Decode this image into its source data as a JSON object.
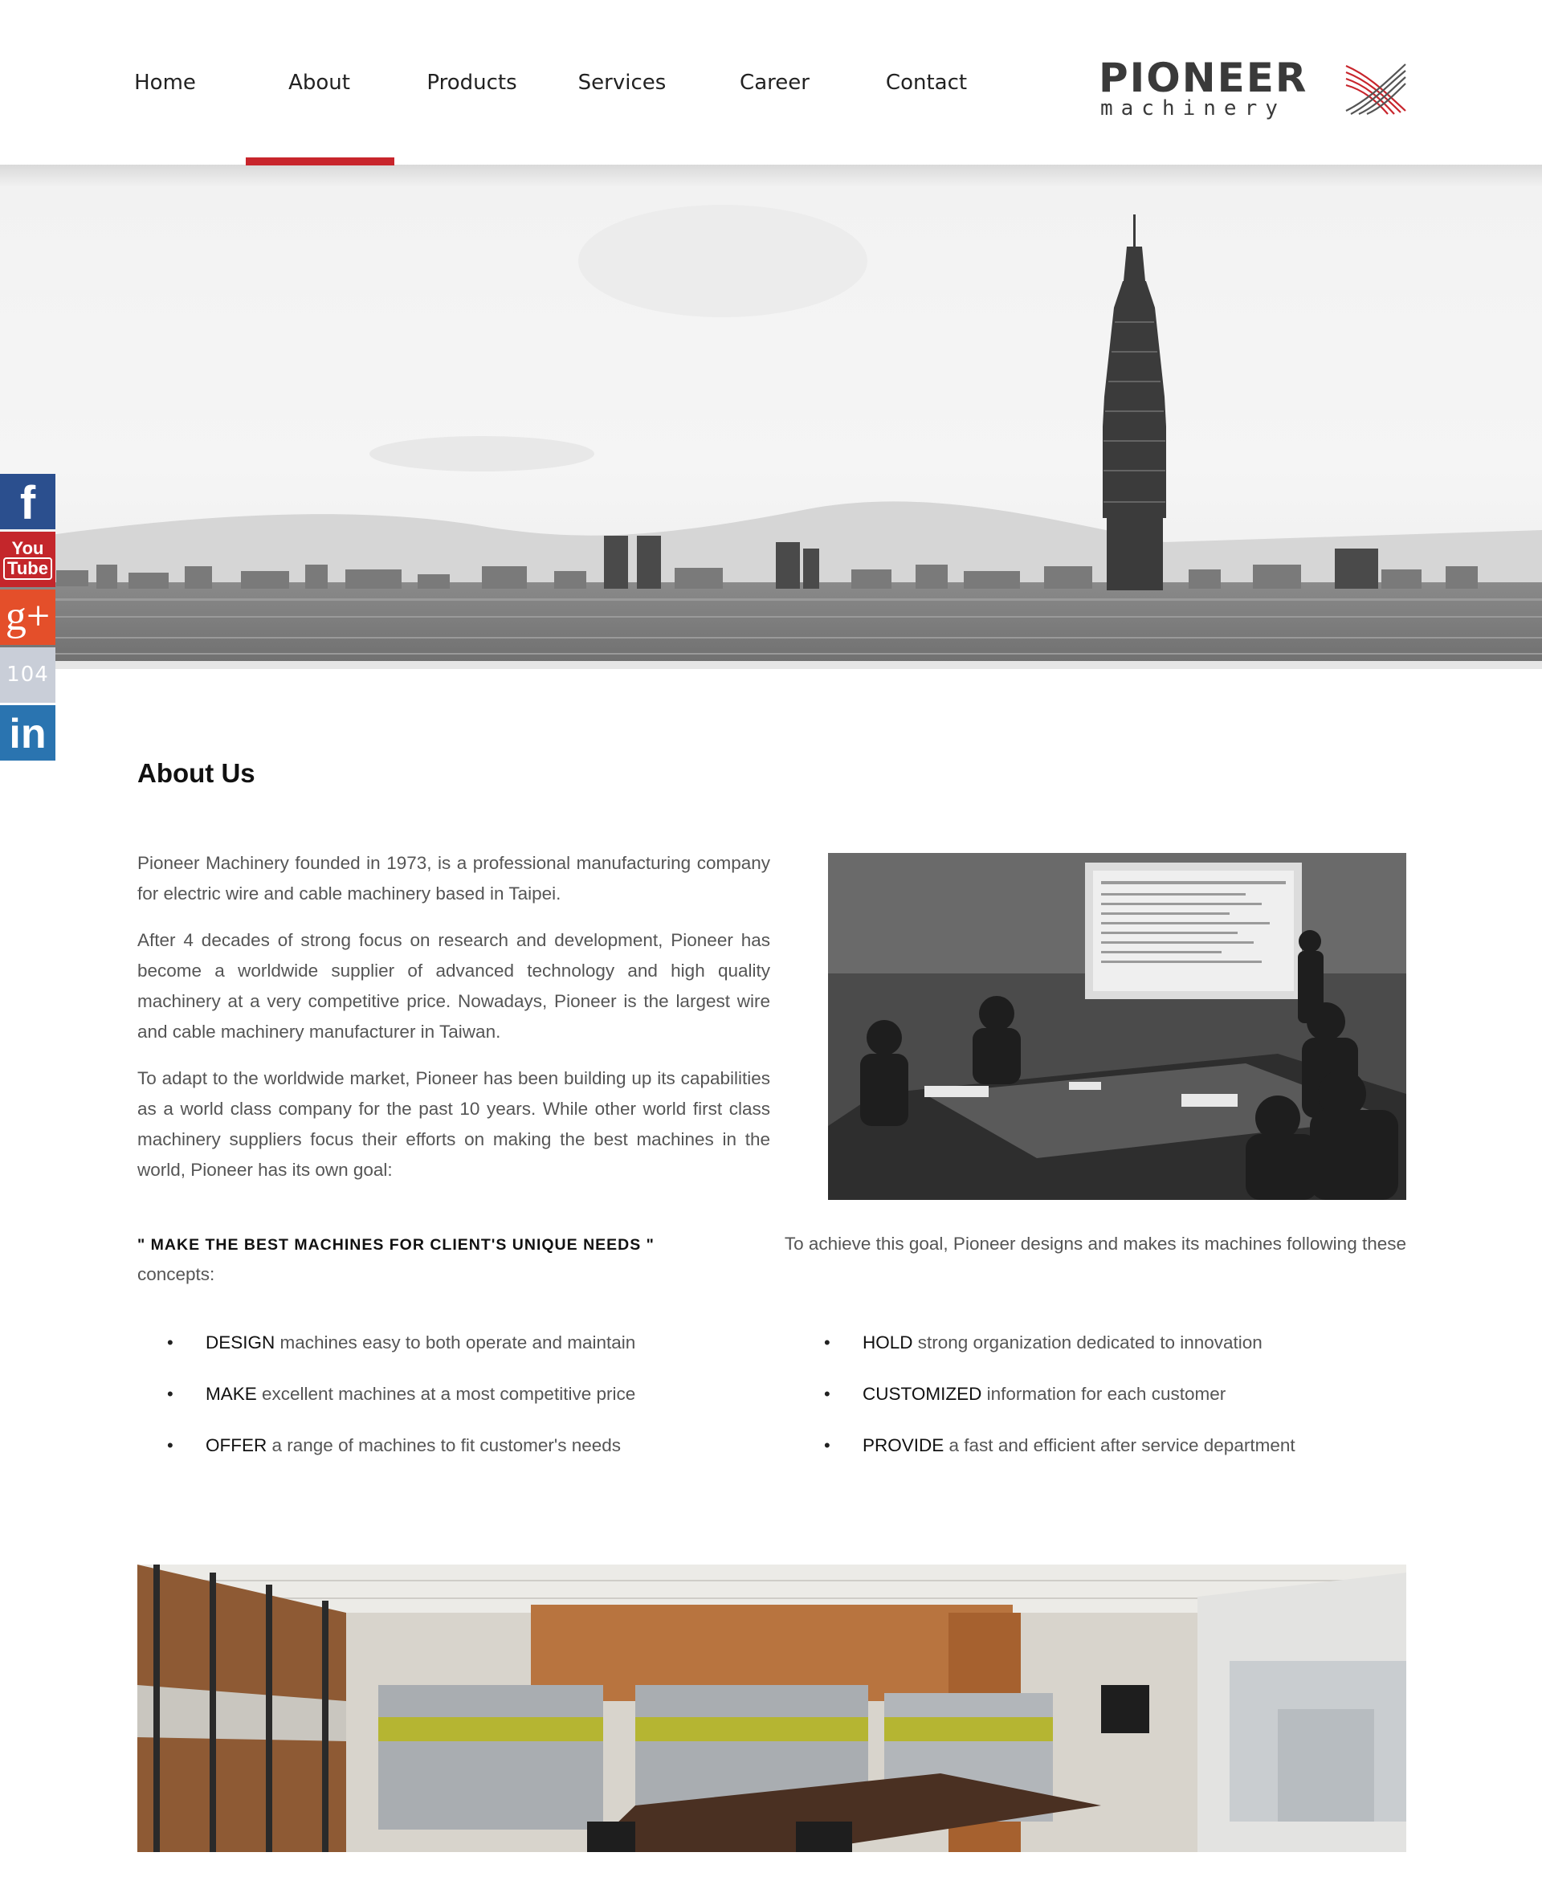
{
  "nav": {
    "items": [
      {
        "label": "Home"
      },
      {
        "label": "About"
      },
      {
        "label": "Products"
      },
      {
        "label": "Services"
      },
      {
        "label": "Career"
      },
      {
        "label": "Contact"
      }
    ],
    "active_index": 1,
    "accent_color": "#c8252c"
  },
  "logo": {
    "name": "PIONEER",
    "sub": "machinery"
  },
  "social": {
    "facebook": "f",
    "youtube_top": "You",
    "youtube_bottom": "Tube",
    "googleplus": "g+",
    "job104": "104",
    "linkedin": "in"
  },
  "about": {
    "title": "About Us",
    "paragraphs": [
      "Pioneer Machinery founded in 1973, is a professional manufacturing company for electric wire and cable machinery based in Taipei.",
      "After 4 decades of strong focus on research and development, Pioneer has become a worldwide supplier of advanced technology and high quality machinery at a very competitive price. Nowadays, Pioneer is the largest wire and cable machinery manufacturer in Taiwan.",
      "To adapt to the worldwide market, Pioneer has been building up its capabilities as a world class company for the past 10 years. While other world first class machinery suppliers focus their efforts on making the best machines in the world, Pioneer has its own goal:"
    ],
    "goal_quote": "\" MAKE THE BEST MACHINES FOR CLIENT'S UNIQUE NEEDS \"",
    "goal_continuation": "To achieve this goal, Pioneer designs and makes its machines following these",
    "goal_end": "concepts:",
    "concepts_left": [
      {
        "keyword": "DESIGN",
        "text": " machines easy to both operate and maintain"
      },
      {
        "keyword": "MAKE",
        "text": " excellent machines at a most competitive price"
      },
      {
        "keyword": "OFFER",
        "text": " a range of machines to fit customer's needs"
      }
    ],
    "concepts_right": [
      {
        "keyword": "HOLD",
        "text": " strong organization dedicated to innovation"
      },
      {
        "keyword": "CUSTOMIZED",
        "text": " information for each customer"
      },
      {
        "keyword": "PROVIDE",
        "text": " a fast and efficient after service department"
      }
    ],
    "bullet": "•"
  }
}
